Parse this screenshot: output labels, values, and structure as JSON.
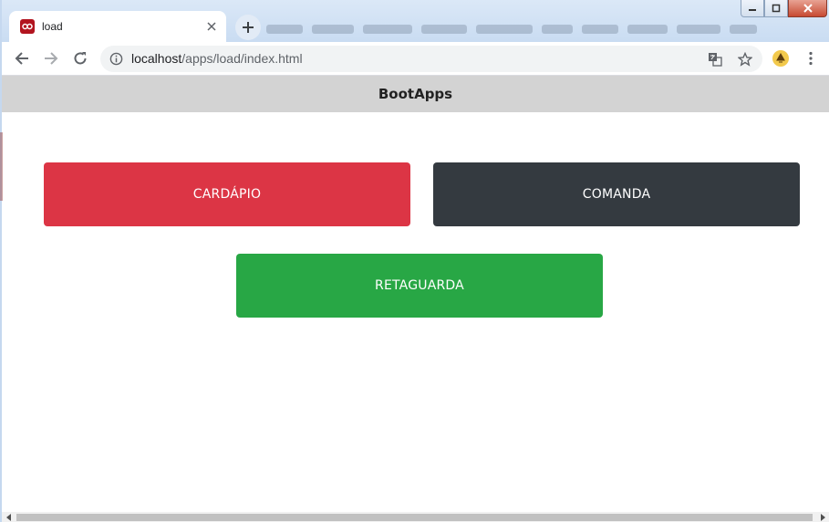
{
  "browser": {
    "tab": {
      "title": "load",
      "favicon": "app-logo-icon"
    },
    "address": {
      "host": "localhost",
      "path": "/apps/load/index.html"
    }
  },
  "page": {
    "header": {
      "title": "BootApps"
    },
    "buttons": [
      {
        "label": "CARDÁPIO",
        "color": "#dc3545"
      },
      {
        "label": "COMANDA",
        "color": "#343a40"
      },
      {
        "label": "RETAGUARDA",
        "color": "#28a745"
      }
    ]
  },
  "icons": {
    "back": "arrow-left-icon",
    "forward": "arrow-right-icon",
    "reload": "reload-icon",
    "info": "info-icon",
    "translate": "translate-icon",
    "bookmark": "star-icon",
    "extension": "extension-icon",
    "menu": "kebab-menu-icon"
  }
}
